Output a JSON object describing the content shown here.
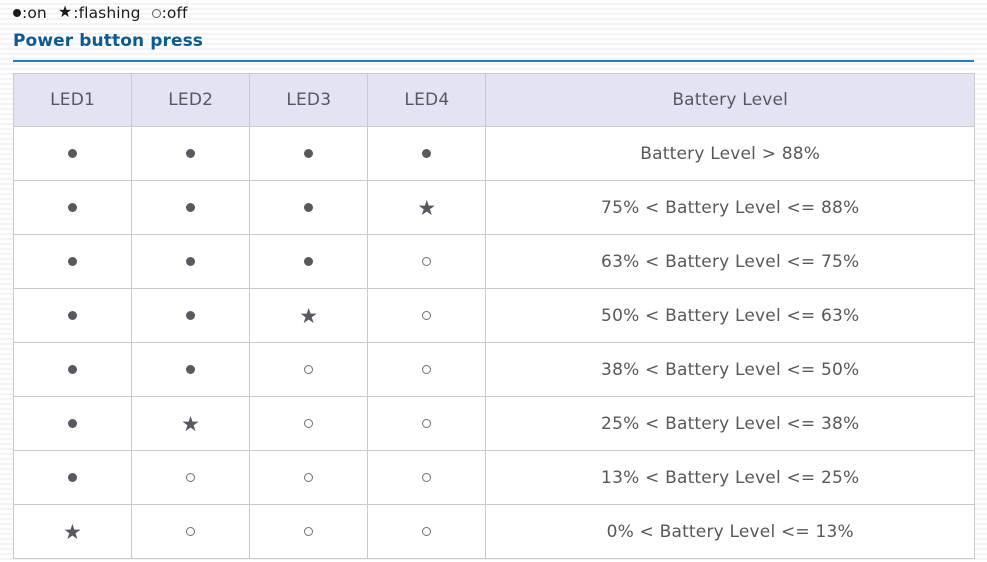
{
  "legend": {
    "items": [
      {
        "symbol": "on",
        "glyph": "●",
        "label": ":on"
      },
      {
        "symbol": "flashing",
        "glyph": "★",
        "label": ":flashing"
      },
      {
        "symbol": "off",
        "glyph": "○",
        "label": ":off"
      }
    ]
  },
  "section": {
    "title": "Power button press"
  },
  "colors": {
    "heading": "#0b5a96",
    "rule": "#1a7fc4",
    "header_bg": "#e4e3f3",
    "border": "#c9c9ce",
    "text": "#58585c",
    "symbol": "#585860"
  },
  "table": {
    "headers": [
      "LED1",
      "LED2",
      "LED3",
      "LED4",
      "Battery Level"
    ],
    "rows": [
      {
        "leds": [
          "on",
          "on",
          "on",
          "on"
        ],
        "level": "Battery Level > 88%"
      },
      {
        "leds": [
          "on",
          "on",
          "on",
          "flashing"
        ],
        "level": "75% < Battery Level <= 88%"
      },
      {
        "leds": [
          "on",
          "on",
          "on",
          "off"
        ],
        "level": "63% < Battery Level <= 75%"
      },
      {
        "leds": [
          "on",
          "on",
          "flashing",
          "off"
        ],
        "level": "50% < Battery Level <= 63%"
      },
      {
        "leds": [
          "on",
          "on",
          "off",
          "off"
        ],
        "level": "38% < Battery Level <= 50%"
      },
      {
        "leds": [
          "on",
          "flashing",
          "off",
          "off"
        ],
        "level": "25% < Battery Level <= 38%"
      },
      {
        "leds": [
          "on",
          "off",
          "off",
          "off"
        ],
        "level": "13% < Battery Level <= 25%"
      },
      {
        "leds": [
          "flashing",
          "off",
          "off",
          "off"
        ],
        "level": "0% < Battery Level <= 13%"
      }
    ]
  }
}
